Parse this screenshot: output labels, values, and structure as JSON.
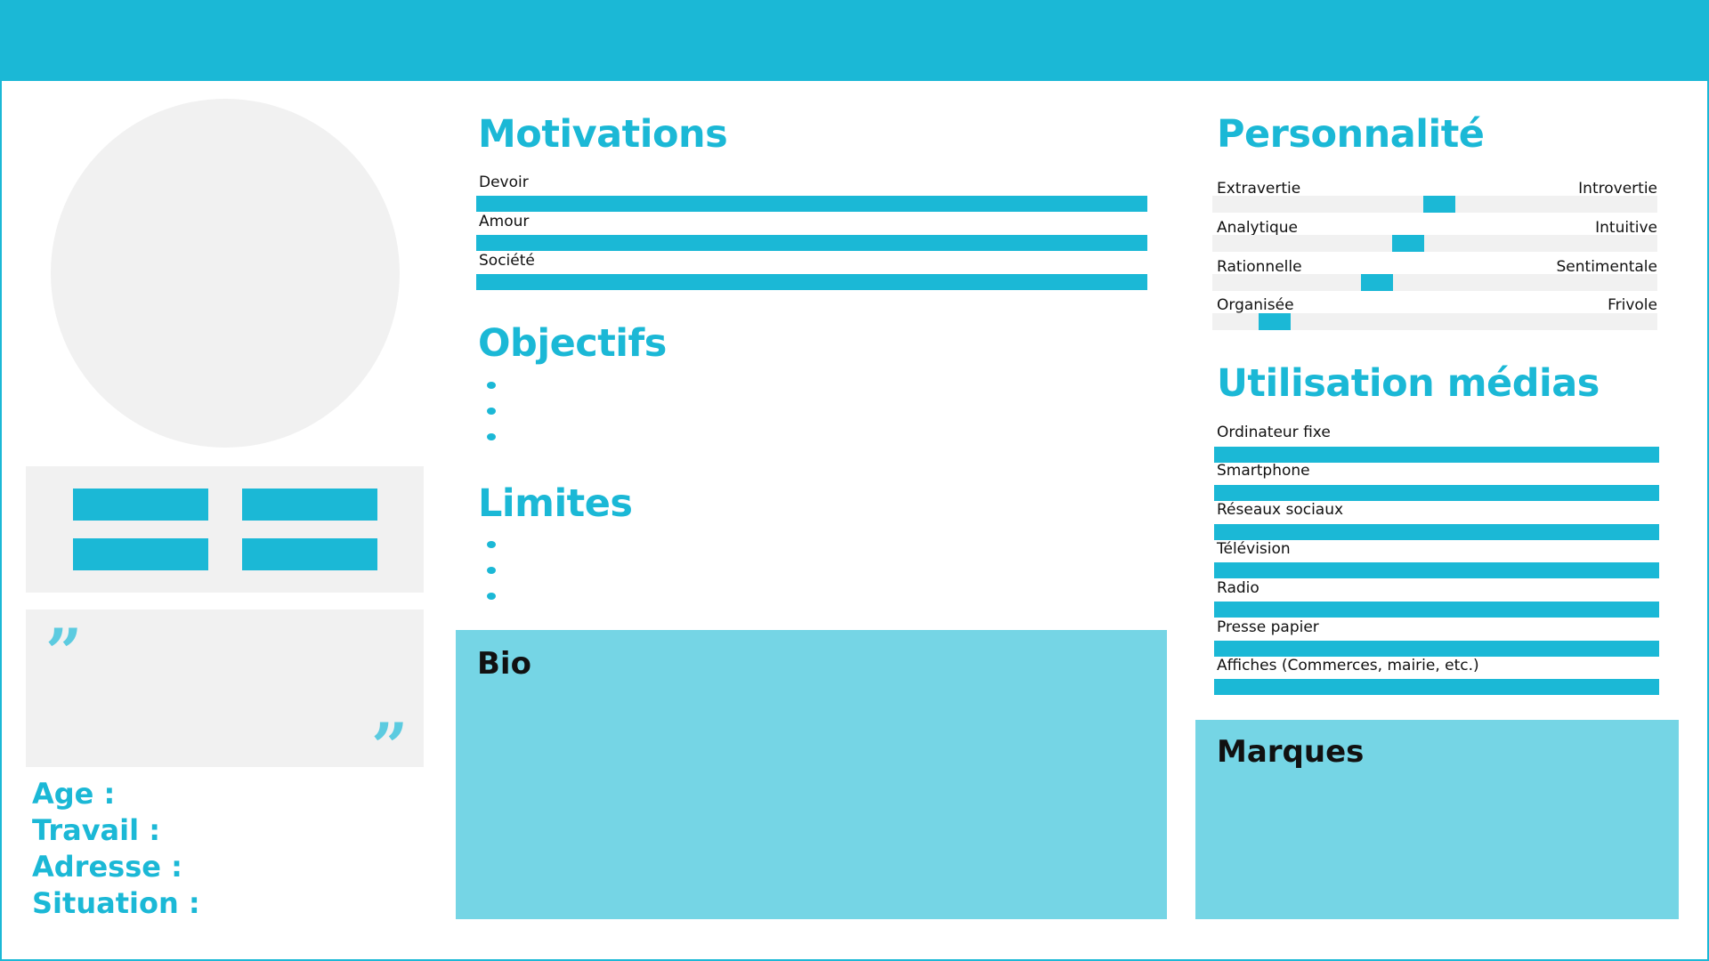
{
  "colors": {
    "accent": "#1bb8d6",
    "box_fill": "#75d5e5",
    "panel_gray": "#f1f1f1"
  },
  "left": {
    "info": {
      "age": "Age :",
      "work": "Travail :",
      "address": "Adresse :",
      "situation": "Situation :"
    },
    "quote": {
      "open_mark": "”",
      "close_mark": "”"
    }
  },
  "motivations": {
    "title": "Motivations",
    "items": [
      {
        "label": "Devoir",
        "value": 100
      },
      {
        "label": "Amour",
        "value": 100
      },
      {
        "label": "Société",
        "value": 100
      }
    ]
  },
  "objectifs": {
    "title": "Objectifs"
  },
  "limites": {
    "title": "Limites"
  },
  "bio": {
    "title": "Bio"
  },
  "personnalite": {
    "title": "Personnalité",
    "scales": [
      {
        "left": "Extravertie",
        "right": "Introvertie",
        "position": 0.51
      },
      {
        "left": "Analytique",
        "right": "Intuitive",
        "position": 0.44
      },
      {
        "left": "Rationnelle",
        "right": "Sentimentale",
        "position": 0.37
      },
      {
        "left": "Organisée",
        "right": "Frivole",
        "position": 0.14
      }
    ]
  },
  "medias": {
    "title": "Utilisation médias",
    "items": [
      {
        "label": "Ordinateur fixe",
        "value": 100
      },
      {
        "label": "Smartphone",
        "value": 100
      },
      {
        "label": "Réseaux sociaux",
        "value": 100
      },
      {
        "label": "Télévision",
        "value": 100
      },
      {
        "label": "Radio",
        "value": 100
      },
      {
        "label": "Presse papier",
        "value": 100
      },
      {
        "label": "Affiches (Commerces, mairie, etc.)",
        "value": 100
      }
    ]
  },
  "marques": {
    "title": "Marques"
  }
}
